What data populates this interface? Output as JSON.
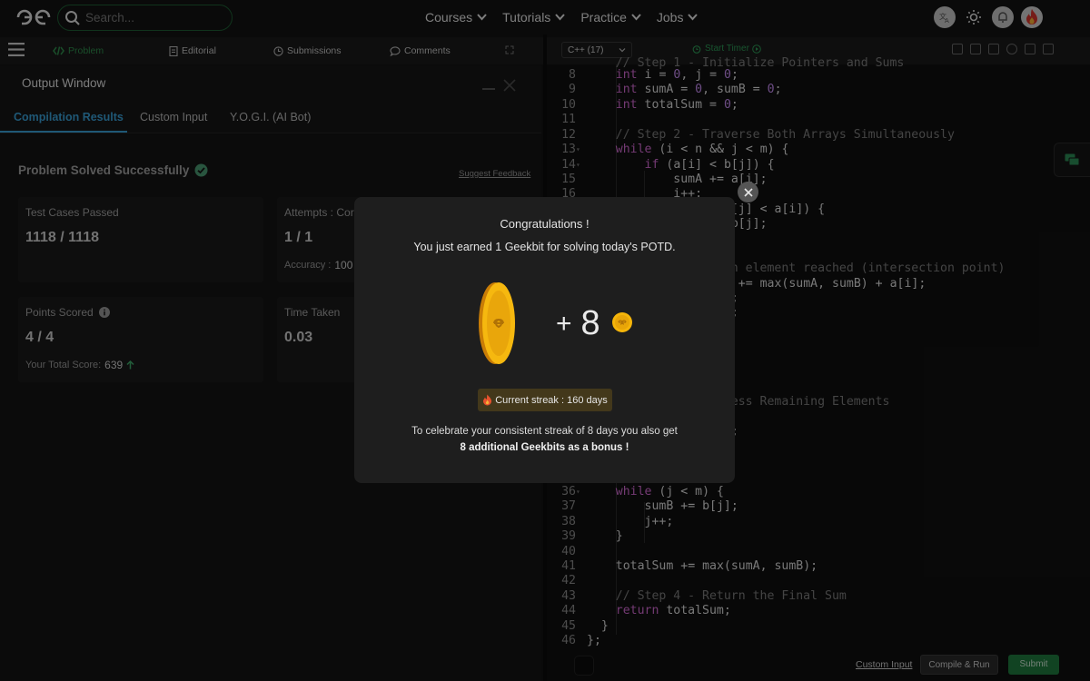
{
  "nav": {
    "search_placeholder": "Search...",
    "menu": [
      "Courses",
      "Tutorials",
      "Practice",
      "Jobs"
    ]
  },
  "problem_tabs": {
    "problem": "Problem",
    "editorial": "Editorial",
    "submissions": "Submissions",
    "comments": "Comments"
  },
  "output": {
    "title": "Output Window",
    "tabs": [
      "Compilation Results",
      "Custom Input",
      "Y.O.G.I. (AI Bot)"
    ],
    "status": "Problem Solved Successfully",
    "feedback_link": "Suggest Feedback",
    "test_cases_label": "Test Cases Passed",
    "test_cases_value": "1118 / 1118",
    "attempts_label": "Attempts : Corr",
    "attempts_value": "1 / 1",
    "accuracy_label": "Accuracy :",
    "accuracy_value": "100",
    "points_label": "Points Scored",
    "points_value": "4 / 4",
    "total_score_label": "Your Total Score:",
    "total_score_value": "639",
    "time_label": "Time Taken",
    "time_value": "0.03"
  },
  "editor": {
    "language": "C++ (17)",
    "timer_label": "Start Timer",
    "custom_input": "Custom Input",
    "compile_label": "Compile & Run",
    "submit_label": "Submit"
  },
  "modal": {
    "title": "Congratulations !",
    "subtitle": "You just earned 1 Geekbit for solving today's POTD.",
    "plus": "+",
    "reward_amount": "8",
    "streak": "Current streak : 160 days",
    "bonus_line1": "To celebrate your consistent streak of 8 days you also get",
    "bonus_line2": "8 additional Geekbits as a bonus !"
  },
  "colors": {
    "accent_green": "#2f8f4e",
    "tab_blue": "#3aa0d8",
    "coin_gold": "#f5b50a",
    "keyword": "#d36bd3",
    "number": "#c78cf2",
    "comment": "#7d7d7d"
  }
}
